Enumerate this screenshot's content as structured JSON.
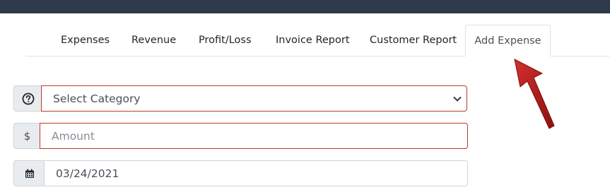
{
  "tabs": [
    {
      "label": "Expenses"
    },
    {
      "label": "Revenue"
    },
    {
      "label": "Profit/Loss"
    },
    {
      "label": "Invoice Report"
    },
    {
      "label": "Customer Report"
    },
    {
      "label": "Add Expense",
      "active": true
    }
  ],
  "form": {
    "category": {
      "value": "Select Category",
      "icon": "question-circle-icon"
    },
    "amount": {
      "prefix": "$",
      "placeholder": "Amount",
      "value": ""
    },
    "date": {
      "value": "03/24/2021",
      "icon": "calendar-icon"
    }
  },
  "colors": {
    "topbar": "#2e3a4b",
    "invalid_border": "#c0392b",
    "annotation_arrow": "#b71c1c"
  }
}
